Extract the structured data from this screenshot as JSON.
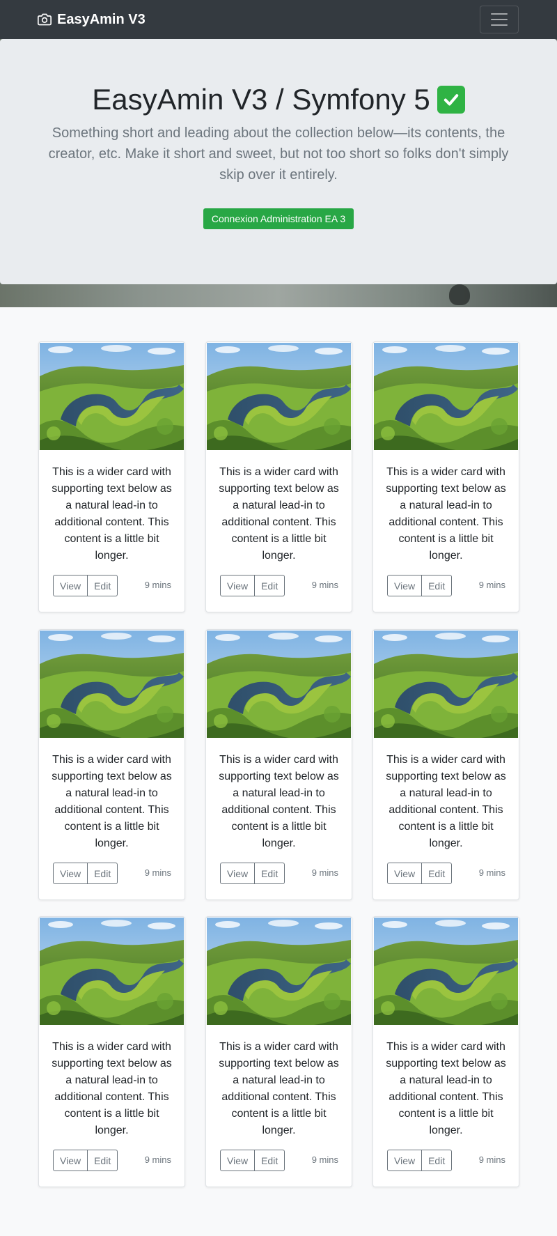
{
  "navbar": {
    "brand": "EasyAmin V3",
    "brand_icon": "camera-icon",
    "toggler_icon": "hamburger-icon"
  },
  "hero": {
    "title": "EasyAmin V3 / Symfony 5",
    "title_icon": "check-mark-icon",
    "lead": "Something short and leading about the collection below—its contents, the creator, etc. Make it short and sweet, but not too short so folks don't simply skip over it entirely.",
    "cta_label": "Connexion Administration EA 3",
    "cta_color": "#28a745"
  },
  "cards": [
    {
      "text": "This is a wider card with supporting text below as a natural lead-in to additional content. This content is a little bit longer.",
      "view_label": "View",
      "edit_label": "Edit",
      "time": "9 mins"
    },
    {
      "text": "This is a wider card with supporting text below as a natural lead-in to additional content. This content is a little bit longer.",
      "view_label": "View",
      "edit_label": "Edit",
      "time": "9 mins"
    },
    {
      "text": "This is a wider card with supporting text below as a natural lead-in to additional content. This content is a little bit longer.",
      "view_label": "View",
      "edit_label": "Edit",
      "time": "9 mins"
    },
    {
      "text": "This is a wider card with supporting text below as a natural lead-in to additional content. This content is a little bit longer.",
      "view_label": "View",
      "edit_label": "Edit",
      "time": "9 mins"
    },
    {
      "text": "This is a wider card with supporting text below as a natural lead-in to additional content. This content is a little bit longer.",
      "view_label": "View",
      "edit_label": "Edit",
      "time": "9 mins"
    },
    {
      "text": "This is a wider card with supporting text below as a natural lead-in to additional content. This content is a little bit longer.",
      "view_label": "View",
      "edit_label": "Edit",
      "time": "9 mins"
    },
    {
      "text": "This is a wider card with supporting text below as a natural lead-in to additional content. This content is a little bit longer.",
      "view_label": "View",
      "edit_label": "Edit",
      "time": "9 mins"
    },
    {
      "text": "This is a wider card with supporting text below as a natural lead-in to additional content. This content is a little bit longer.",
      "view_label": "View",
      "edit_label": "Edit",
      "time": "9 mins"
    },
    {
      "text": "This is a wider card with supporting text below as a natural lead-in to additional content. This content is a little bit longer.",
      "view_label": "View",
      "edit_label": "Edit",
      "time": "9 mins"
    }
  ]
}
